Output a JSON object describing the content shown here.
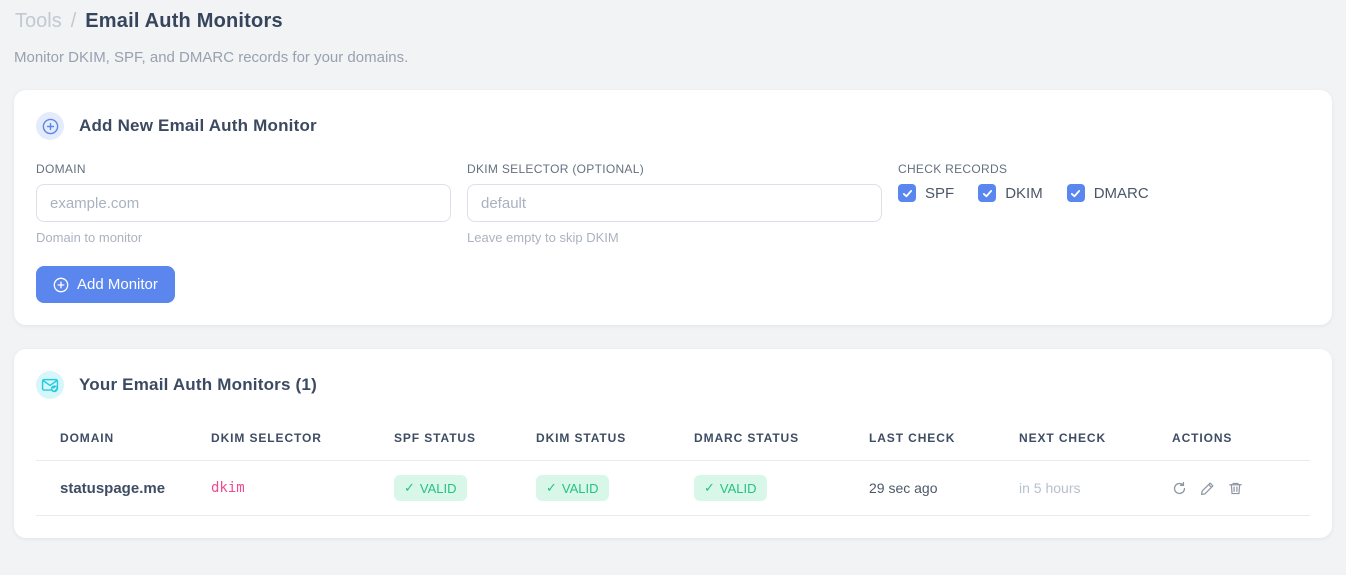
{
  "icons": {
    "check_mark": "✓"
  },
  "breadcrumb": {
    "parent": "Tools",
    "separator": "/",
    "current": "Email Auth Monitors"
  },
  "subtitle": "Monitor DKIM, SPF, and DMARC records for your domains.",
  "colors": {
    "accent_blue": "#5b86ee",
    "accent_cyan": "#26ccdf",
    "valid_green": "#25c281",
    "valid_bg": "#d9f7e8",
    "selector_pink": "#ed4c8e"
  },
  "add_card": {
    "title": "Add New Email Auth Monitor",
    "domain_field": {
      "label": "DOMAIN",
      "placeholder": "example.com",
      "value": "",
      "hint": "Domain to monitor"
    },
    "selector_field": {
      "label": "DKIM SELECTOR (OPTIONAL)",
      "placeholder": "default",
      "value": "",
      "hint": "Leave empty to skip DKIM"
    },
    "check_records": {
      "label": "CHECK RECORDS",
      "options": [
        {
          "label": "SPF",
          "checked": true
        },
        {
          "label": "DKIM",
          "checked": true
        },
        {
          "label": "DMARC",
          "checked": true
        }
      ]
    },
    "submit_label": "Add Monitor"
  },
  "monitors_card": {
    "title": "Your Email Auth Monitors (1)",
    "table": {
      "headers": [
        "DOMAIN",
        "DKIM SELECTOR",
        "SPF STATUS",
        "DKIM STATUS",
        "DMARC STATUS",
        "LAST CHECK",
        "NEXT CHECK",
        "ACTIONS"
      ],
      "rows": [
        {
          "domain": "statuspage.me",
          "dkim_selector": "dkim",
          "spf_status": "VALID",
          "dkim_status": "VALID",
          "dmarc_status": "VALID",
          "last_check": "29 sec ago",
          "next_check": "in 5 hours"
        }
      ]
    }
  }
}
